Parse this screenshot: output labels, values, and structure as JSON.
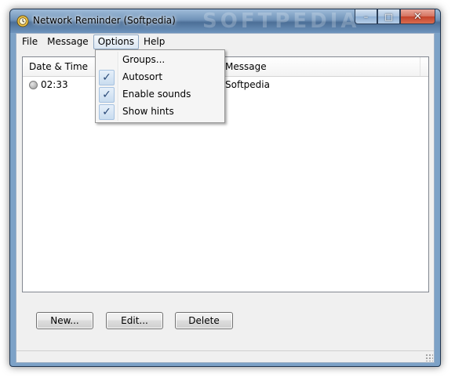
{
  "window": {
    "title": "Network Reminder (Softpedia)",
    "watermark": "SOFTPEDIA",
    "controls": {
      "minimize": "–",
      "maximize": "□",
      "close": "✕"
    }
  },
  "menu": {
    "items": [
      "File",
      "Message",
      "Options",
      "Help"
    ],
    "active": "Options"
  },
  "options_menu": [
    {
      "label": "Groups...",
      "checked": false
    },
    {
      "label": "Autosort",
      "checked": true
    },
    {
      "label": "Enable sounds",
      "checked": true
    },
    {
      "label": "Show hints",
      "checked": true
    }
  ],
  "list": {
    "columns": [
      "Date & Time",
      "Message"
    ],
    "rows": [
      {
        "time": "02:33",
        "message": "Softpedia",
        "status_icon": "grey-circle-icon"
      }
    ]
  },
  "buttons": {
    "new": "New...",
    "edit": "Edit...",
    "delete": "Delete"
  },
  "colors": {
    "check": "#2a4a78",
    "title_glass": "#6f92b8"
  }
}
